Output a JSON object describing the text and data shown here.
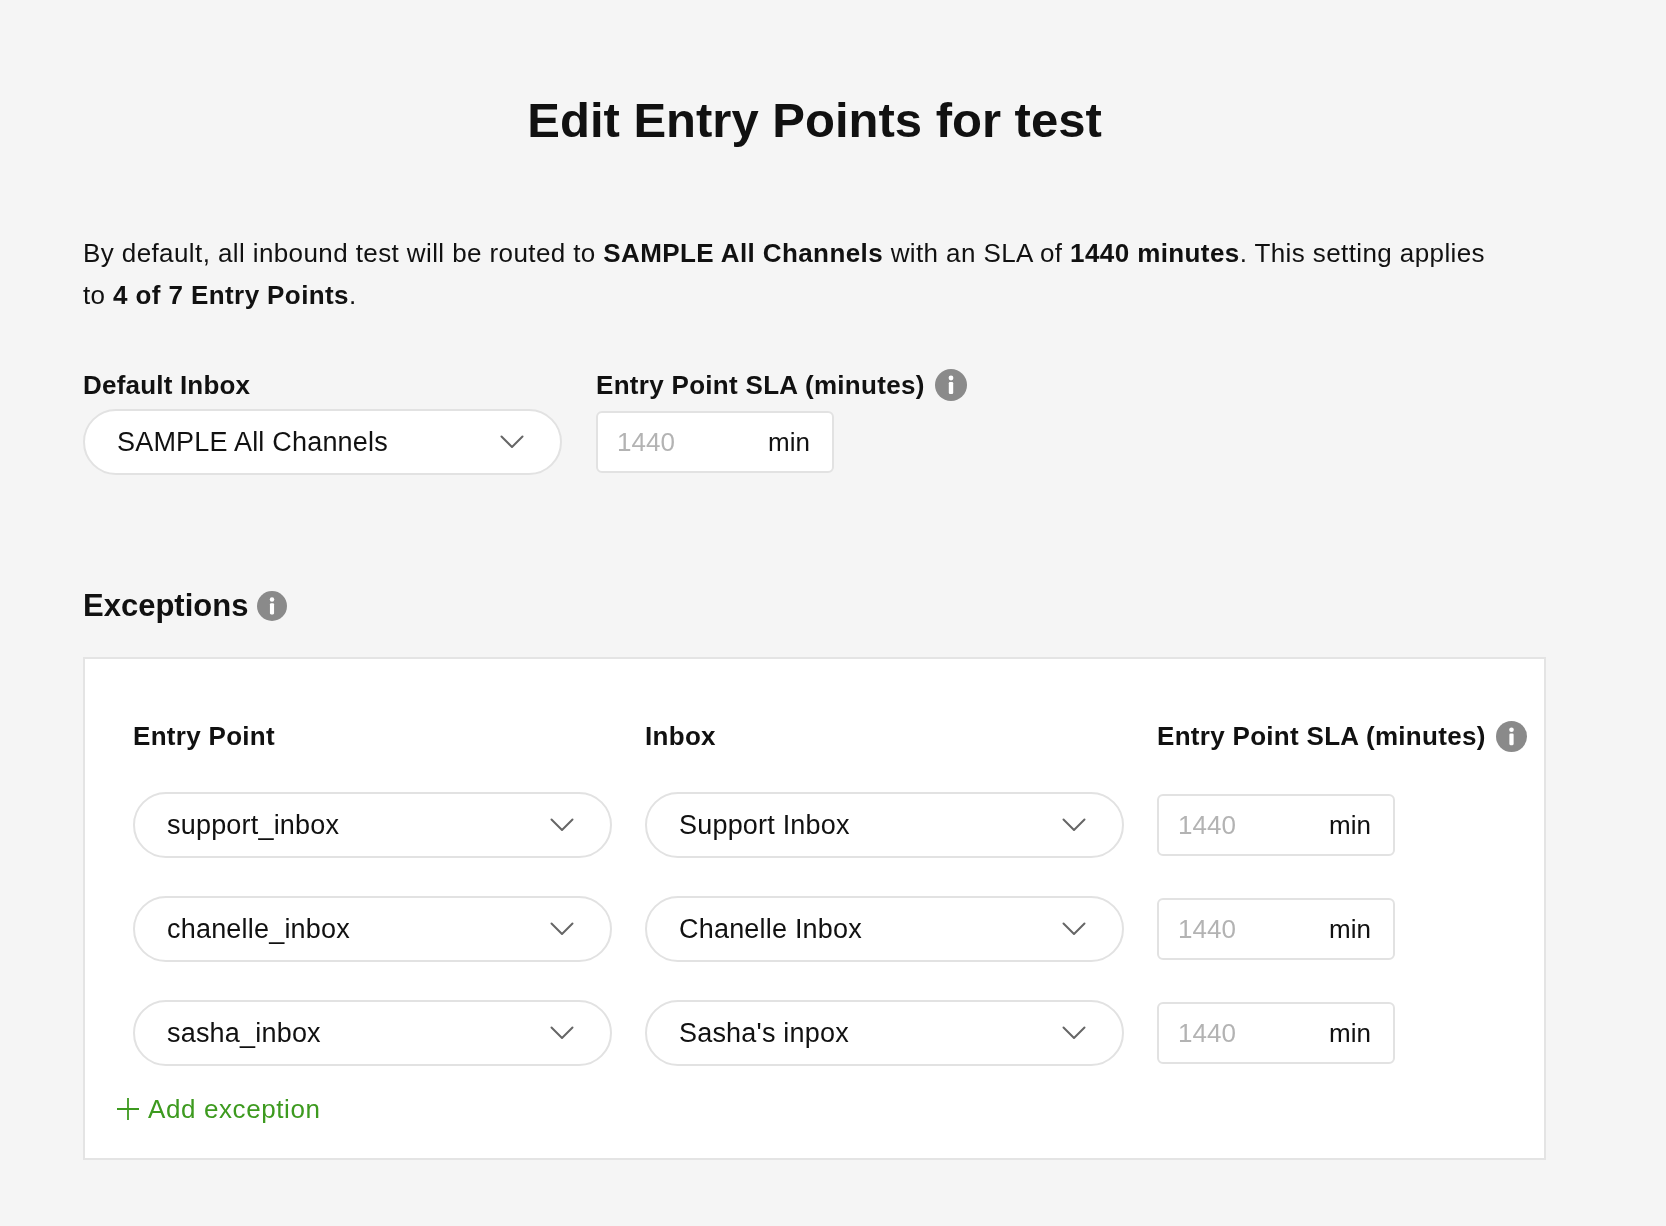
{
  "title": "Edit Entry Points for test",
  "description": "By default, all inbound test will be routed to **SAMPLE All Channels** with an SLA of **1440 minutes**. This setting applies to **4 of 7 Entry Points**.",
  "default_inbox": {
    "label": "Default Inbox",
    "value": "SAMPLE All Channels"
  },
  "default_sla": {
    "label": "Entry Point SLA (minutes)",
    "info": true,
    "placeholder": "1440",
    "unit": "min"
  },
  "exceptions": {
    "title": "Exceptions",
    "info": true,
    "columns": [
      {
        "label": "Entry Point",
        "info": false
      },
      {
        "label": "Inbox",
        "info": false
      },
      {
        "label": "Entry Point SLA (minutes)",
        "info": true
      }
    ],
    "rows": [
      {
        "entry_point": "support_inbox",
        "inbox": "Support Inbox",
        "sla_placeholder": "1440",
        "unit": "min"
      },
      {
        "entry_point": "chanelle_inbox",
        "inbox": "Chanelle Inbox",
        "sla_placeholder": "1440",
        "unit": "min"
      },
      {
        "entry_point": "sasha_inbox",
        "inbox": "Sasha's inpox",
        "sla_placeholder": "1440",
        "unit": "min"
      }
    ],
    "add_button": "Add exception"
  }
}
